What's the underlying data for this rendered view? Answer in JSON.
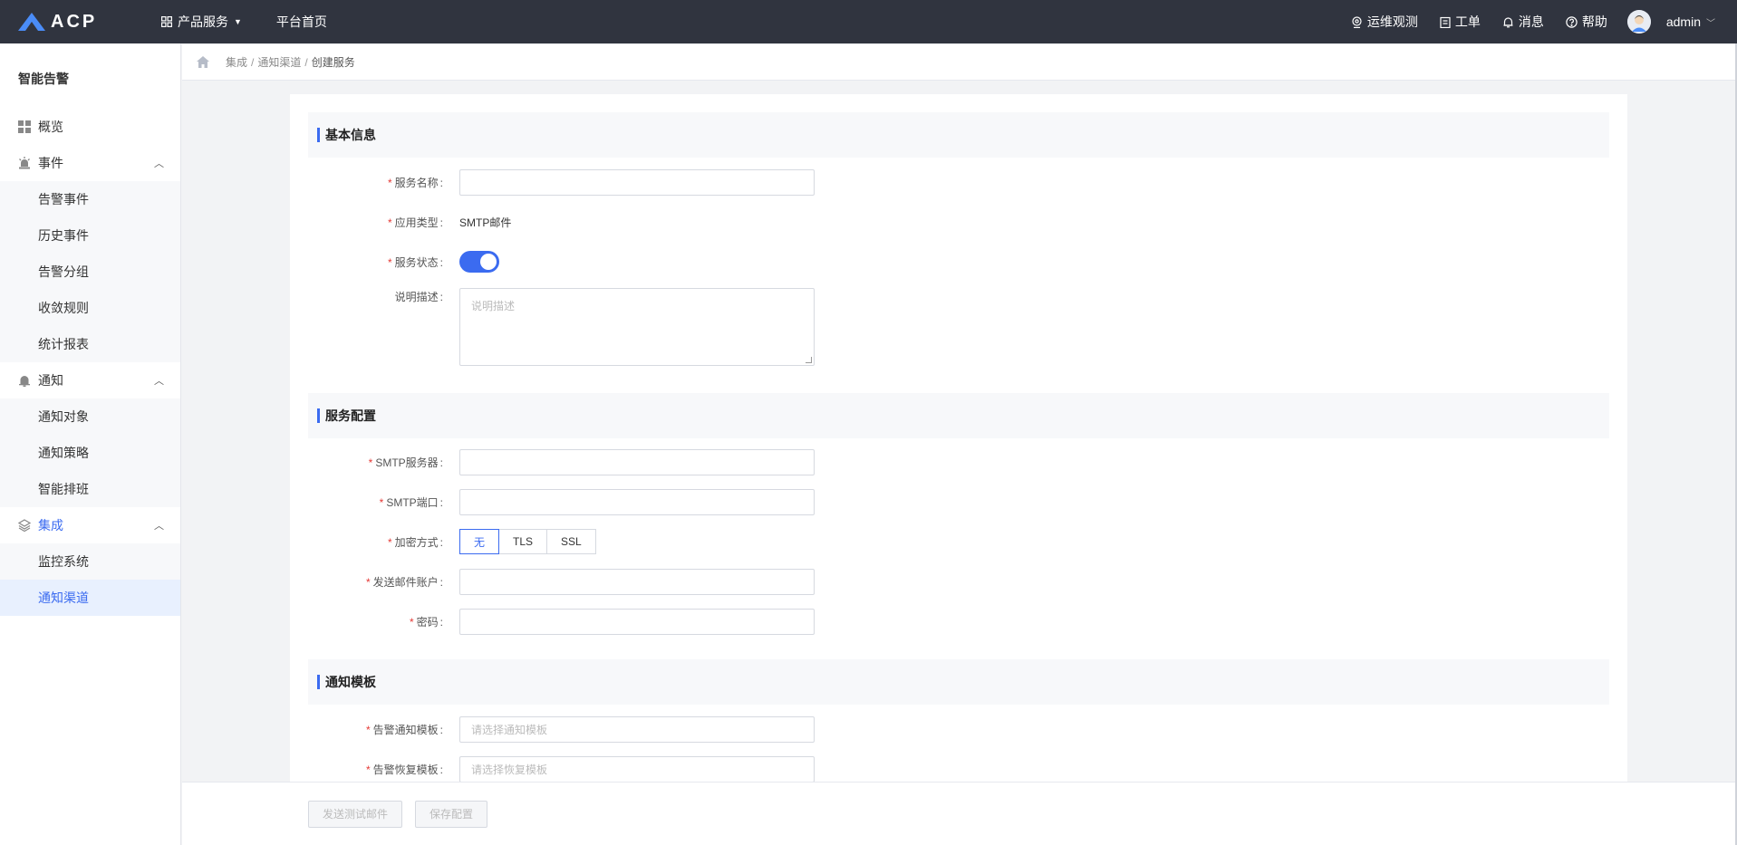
{
  "app": {
    "logo_text": "ACP",
    "menu": {
      "products": "产品服务",
      "home": "平台首页"
    }
  },
  "topbar": {
    "ops": "运维观测",
    "ticket": "工单",
    "messages": "消息",
    "help": "帮助",
    "user": "admin"
  },
  "sidebar": {
    "title": "智能告警",
    "overview": "概览",
    "events": {
      "label": "事件",
      "items": [
        "告警事件",
        "历史事件",
        "告警分组",
        "收敛规则",
        "统计报表"
      ]
    },
    "notify": {
      "label": "通知",
      "items": [
        "通知对象",
        "通知策略",
        "智能排班"
      ]
    },
    "integration": {
      "label": "集成",
      "items": [
        "监控系统",
        "通知渠道"
      ]
    }
  },
  "breadcrumb": {
    "a": "集成",
    "b": "通知渠道",
    "c": "创建服务",
    "sep": "/"
  },
  "basic": {
    "title": "基本信息",
    "name_label": "服务名称",
    "type_label": "应用类型",
    "type_value": "SMTP邮件",
    "status_label": "服务状态",
    "status_on": true,
    "desc_label": "说明描述",
    "desc_placeholder": "说明描述"
  },
  "config": {
    "title": "服务配置",
    "server_label": "SMTP服务器",
    "port_label": "SMTP端口",
    "enc_label": "加密方式",
    "enc_options": [
      "无",
      "TLS",
      "SSL"
    ],
    "enc_selected": "无",
    "account_label": "发送邮件账户",
    "password_label": "密码"
  },
  "template": {
    "title": "通知模板",
    "alert_label": "告警通知模板",
    "alert_placeholder": "请选择通知模板",
    "recover_label": "告警恢复模板",
    "recover_placeholder": "请选择恢复模板"
  },
  "footer": {
    "test": "发送测试邮件",
    "save": "保存配置"
  },
  "colors": {
    "topbar": "#30343f",
    "accent": "#3b6bf0",
    "required": "#e53935"
  }
}
